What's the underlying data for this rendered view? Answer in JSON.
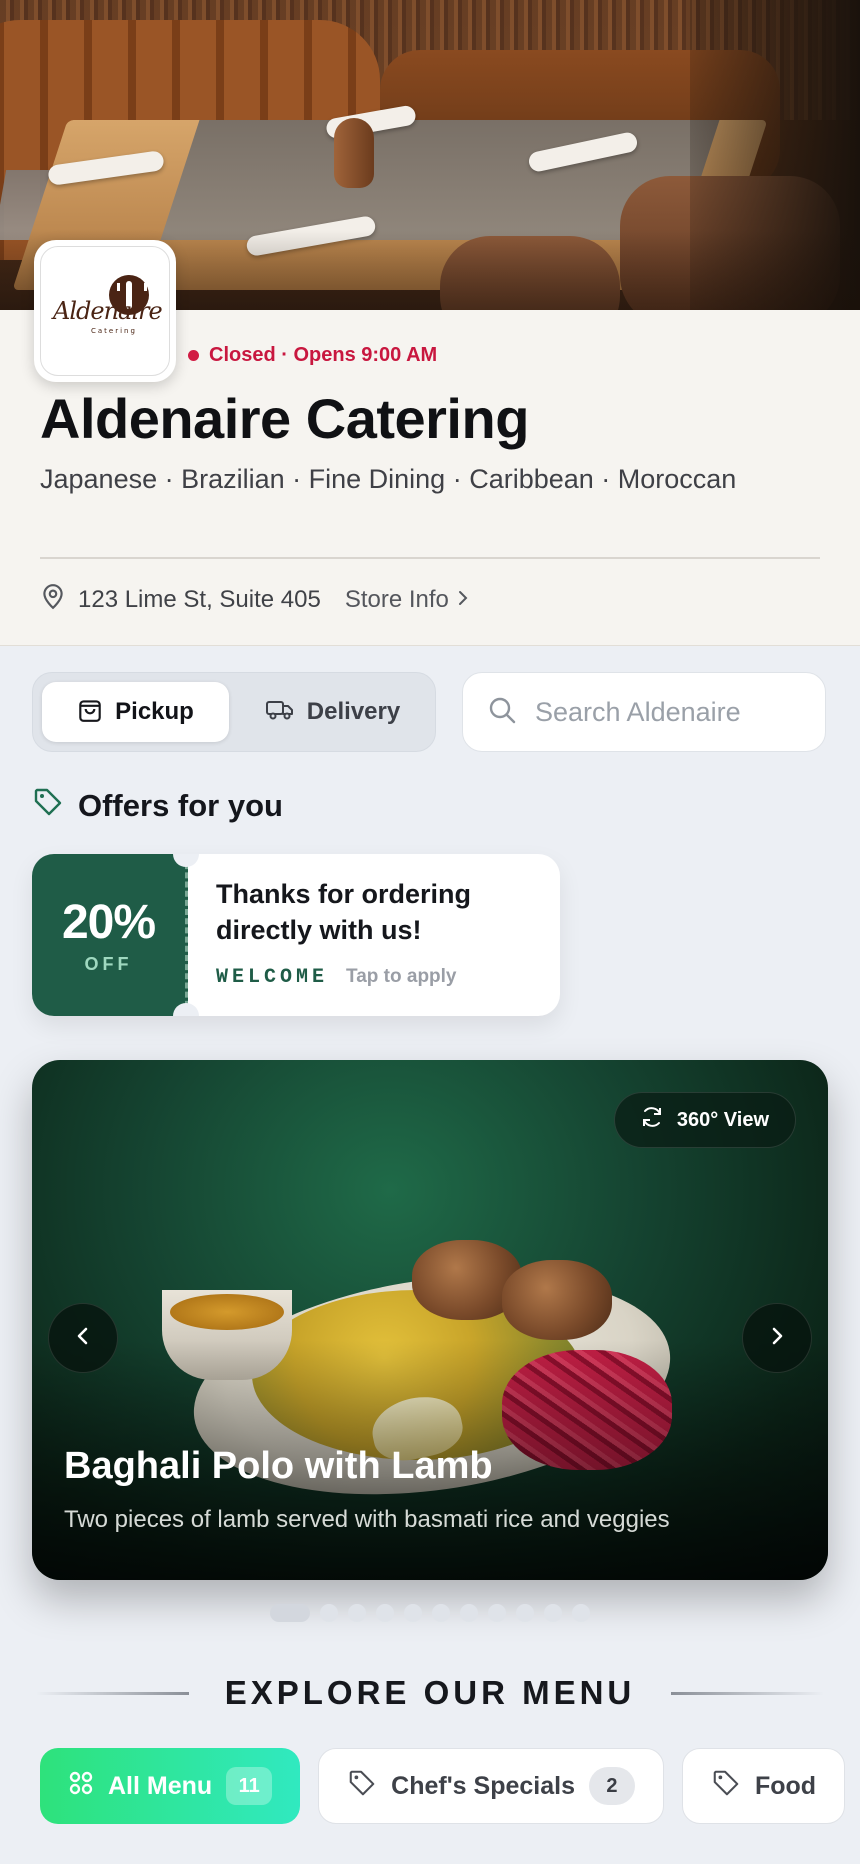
{
  "store": {
    "status_text": "Closed · Opens 9:00 AM",
    "name": "Aldenaire Catering",
    "cuisines": "Japanese · Brazilian · Fine Dining · Caribbean · Moroccan",
    "address": "123 Lime St, Suite 405",
    "store_info_label": "Store Info",
    "logo": {
      "text": "Aldenaire",
      "sub": "Catering"
    }
  },
  "order_mode": {
    "options": [
      {
        "label": "Pickup",
        "icon": "shopping-bag-icon",
        "active": true
      },
      {
        "label": "Delivery",
        "icon": "truck-icon",
        "active": false
      }
    ]
  },
  "search": {
    "placeholder": "Search Aldenaire",
    "value": ""
  },
  "offers": {
    "title": "Offers for you",
    "items": [
      {
        "percent": "20%",
        "off_label": "OFF",
        "headline": "Thanks for ordering directly with us!",
        "code": "WELCOME",
        "action": "Tap to apply"
      }
    ]
  },
  "featured": {
    "view_button": "360° View",
    "title": "Baghali Polo with Lamb",
    "description": "Two pieces of lamb served with basmati rice and veggies",
    "slide_count": 11,
    "active_slide": 1
  },
  "explore": {
    "title": "EXPLORE OUR MENU"
  },
  "categories": [
    {
      "label": "All Menu",
      "count": "11",
      "icon": "grid-icon",
      "active": true
    },
    {
      "label": "Chef's Specials",
      "count": "2",
      "icon": "tag-icon",
      "active": false
    },
    {
      "label": "Food",
      "count": "",
      "icon": "tag-icon",
      "active": false
    }
  ],
  "colors": {
    "status_red": "#c8173f",
    "offer_green": "#1f5c47",
    "chip_active_start": "#2ee27b",
    "chip_active_end": "#30e9c0"
  }
}
